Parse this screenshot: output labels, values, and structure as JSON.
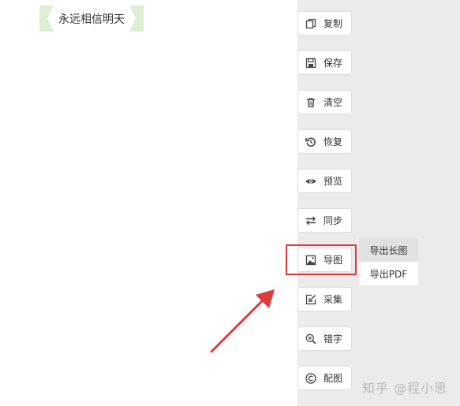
{
  "topic": {
    "label": "永远相信明天"
  },
  "toolbar": {
    "buttons": [
      {
        "label": "复制",
        "icon": "copy-icon"
      },
      {
        "label": "保存",
        "icon": "save-icon"
      },
      {
        "label": "清空",
        "icon": "trash-icon"
      },
      {
        "label": "恢复",
        "icon": "restore-icon"
      },
      {
        "label": "预览",
        "icon": "eye-icon"
      },
      {
        "label": "同步",
        "icon": "sync-icon"
      },
      {
        "label": "导图",
        "icon": "image-icon"
      },
      {
        "label": "采集",
        "icon": "collect-icon"
      },
      {
        "label": "错字",
        "icon": "search-x-icon"
      },
      {
        "label": "配图",
        "icon": "copyright-icon"
      }
    ]
  },
  "export_menu": {
    "items": [
      {
        "label": "导出长图",
        "active": true
      },
      {
        "label": "导出PDF",
        "active": false
      }
    ]
  },
  "watermark": {
    "text": "知乎 @程小思"
  },
  "colors": {
    "highlight": "#e03a3a",
    "arrow": "#e03a3a",
    "tag_green": "#dcefd3",
    "toolbar_bg": "#ebebeb"
  }
}
